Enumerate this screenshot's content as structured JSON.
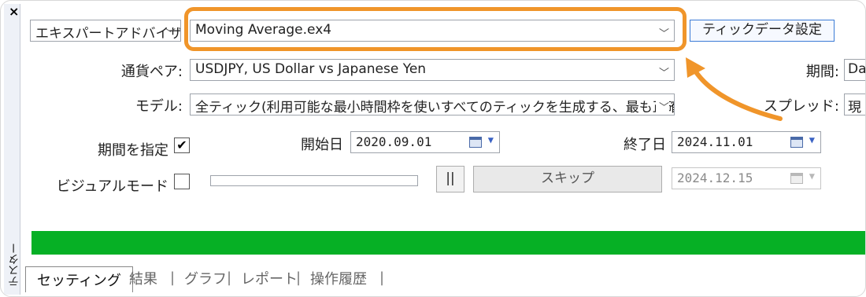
{
  "panel": {
    "title": "テスター",
    "close_glyph": "×"
  },
  "settings": {
    "expert_type": "エキスパートアドバイザ",
    "expert_file": "Moving Average.ex4",
    "tick_data_button": "ティックデータ設定",
    "symbol_label": "通貨ペア:",
    "symbol_value": "USDJPY, US Dollar vs Japanese Yen",
    "period_label": "期間:",
    "period_value": "Da",
    "model_label": "モデル:",
    "model_value": "全ティック(利用可能な最小時間枠を使いすべてのティックを生成する、最も正確",
    "spread_label": "スプレッド:",
    "spread_value": "現",
    "use_date_label": "期間を指定",
    "use_date_checked": true,
    "start_label": "開始日",
    "start_date": "2020.09.01",
    "end_label": "終了日",
    "end_date": "2024.11.01",
    "visual_label": "ビジュアルモード",
    "visual_checked": false,
    "pause_glyph": "||",
    "skip_button": "スキップ",
    "skip_date": "2024.12.15"
  },
  "progress": {
    "value": 1.0,
    "color": "#06b025"
  },
  "tabs": [
    "セッティング",
    "結果",
    "グラフ",
    "レポート",
    "操作履歴"
  ],
  "highlight_color": "#f0952a"
}
